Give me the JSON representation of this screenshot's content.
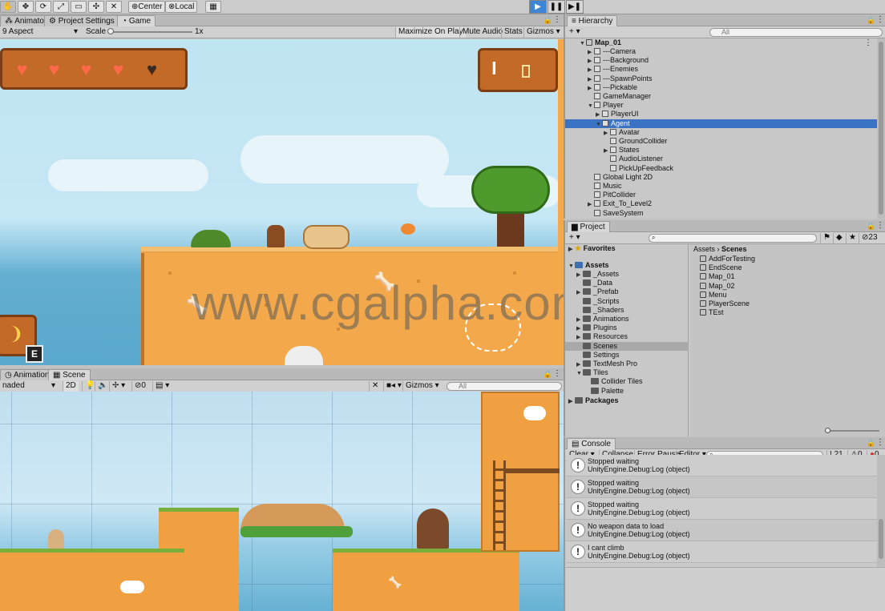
{
  "toolbar": {
    "pivot": "Center",
    "space": "Local"
  },
  "game_panel": {
    "tabs": [
      "Animator",
      "Project Settings",
      "Game"
    ],
    "aspect": "9 Aspect",
    "scale_label": "Scale",
    "scale_value": "1x",
    "buttons": [
      "Maximize On Play",
      "Mute Audio",
      "Stats",
      "Gizmos"
    ],
    "hud_key": "E",
    "hearts": 5
  },
  "scene_panel": {
    "tabs": [
      "Animation",
      "Scene"
    ],
    "shading": "naded",
    "mode_2d": "2D",
    "hidden_count": "0",
    "gizmos": "Gizmos",
    "search_placeholder": "All"
  },
  "hierarchy": {
    "title": "Hierarchy",
    "search_placeholder": "All",
    "scene": "Map_01",
    "items": [
      {
        "label": "---Camera",
        "depth": 1,
        "fold": true
      },
      {
        "label": "---Background",
        "depth": 1,
        "fold": true
      },
      {
        "label": "---Enemies",
        "depth": 1,
        "fold": true
      },
      {
        "label": "---SpawnPoints",
        "depth": 1,
        "fold": true
      },
      {
        "label": "---Pickable",
        "depth": 1,
        "fold": true
      },
      {
        "label": "GameManager",
        "depth": 1,
        "fold": false
      },
      {
        "label": "Player",
        "depth": 1,
        "fold": true
      },
      {
        "label": "PlayerUI",
        "depth": 2,
        "fold": true
      },
      {
        "label": "Agent",
        "depth": 2,
        "fold": true,
        "selected": true
      },
      {
        "label": "Avatar",
        "depth": 3,
        "fold": true
      },
      {
        "label": "GroundCollider",
        "depth": 3,
        "fold": false
      },
      {
        "label": "States",
        "depth": 3,
        "fold": true
      },
      {
        "label": "AudioListener",
        "depth": 3,
        "fold": false
      },
      {
        "label": "PickUpFeedback",
        "depth": 3,
        "fold": false
      },
      {
        "label": "Global Light 2D",
        "depth": 1,
        "fold": false
      },
      {
        "label": "Music",
        "depth": 1,
        "fold": false
      },
      {
        "label": "PitCollider",
        "depth": 1,
        "fold": false
      },
      {
        "label": "Exit_To_Level2",
        "depth": 1,
        "fold": true
      },
      {
        "label": "SaveSystem",
        "depth": 1,
        "fold": false
      }
    ]
  },
  "project": {
    "title": "Project",
    "badge": "23",
    "favorites": "Favorites",
    "assets": "Assets",
    "packages": "Packages",
    "tree": [
      {
        "label": "_Assets",
        "depth": 1
      },
      {
        "label": "_Data",
        "depth": 1
      },
      {
        "label": "_Prefab",
        "depth": 1
      },
      {
        "label": "_Scripts",
        "depth": 1
      },
      {
        "label": "_Shaders",
        "depth": 1
      },
      {
        "label": "Animations",
        "depth": 1
      },
      {
        "label": "Plugins",
        "depth": 1
      },
      {
        "label": "Resources",
        "depth": 1
      },
      {
        "label": "Scenes",
        "depth": 1,
        "selected": true
      },
      {
        "label": "Settings",
        "depth": 1
      },
      {
        "label": "TextMesh Pro",
        "depth": 1
      },
      {
        "label": "Tiles",
        "depth": 1
      },
      {
        "label": "Collider Tiles",
        "depth": 2
      },
      {
        "label": "Palette",
        "depth": 2
      }
    ],
    "breadcrumb": [
      "Assets",
      "Scenes"
    ],
    "files": [
      "AddForTesting",
      "EndScene",
      "Map_01",
      "Map_02",
      "Menu",
      "PlayerScene",
      "TEst"
    ]
  },
  "console": {
    "title": "Console",
    "buttons": [
      "Clear",
      "Collapse",
      "Error Pause",
      "Editor"
    ],
    "counts": {
      "log": "21",
      "warn": "0",
      "error": "0"
    },
    "entries": [
      {
        "msg": "Stopped waiting",
        "src": "UnityEngine.Debug:Log (object)"
      },
      {
        "msg": "Stopped waiting",
        "src": "UnityEngine.Debug:Log (object)"
      },
      {
        "msg": "Stopped waiting",
        "src": "UnityEngine.Debug:Log (object)"
      },
      {
        "msg": "No weapon data to load",
        "src": "UnityEngine.Debug:Log (object)"
      },
      {
        "msg": "I cant climb",
        "src": "UnityEngine.Debug:Log (object)"
      }
    ]
  },
  "watermark": "www.cgalpha.com"
}
